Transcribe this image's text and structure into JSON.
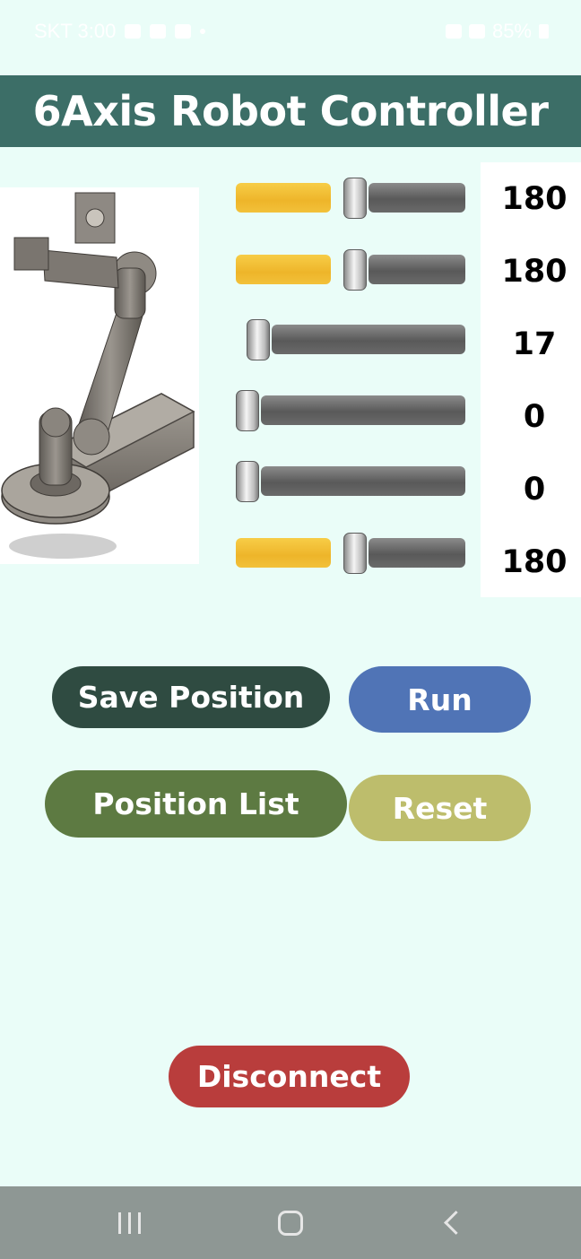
{
  "status_bar": {
    "carrier_time": "SKT 3:00",
    "battery": "85%"
  },
  "title": "6Axis Robot Controller",
  "robot_image": {
    "icon": "robot-arm-image"
  },
  "sliders": [
    {
      "value": "180",
      "level": 0.52,
      "has_fill": true
    },
    {
      "value": "180",
      "level": 0.52,
      "has_fill": true
    },
    {
      "value": "17",
      "level": 0.05,
      "has_fill": false
    },
    {
      "value": "0",
      "level": 0.0,
      "has_fill": false
    },
    {
      "value": "0",
      "level": 0.0,
      "has_fill": false
    },
    {
      "value": "180",
      "level": 0.52,
      "has_fill": true
    }
  ],
  "buttons": {
    "save_position": "Save Position",
    "run": "Run",
    "position_list": "Position List",
    "reset": "Reset",
    "disconnect": "Disconnect"
  },
  "colors": {
    "background": "#eafdf8",
    "title_bar": "#3c6e67",
    "slider_fill": "#eeb52a",
    "save_button": "#2f4b41",
    "run_button": "#5074b6",
    "position_list_button": "#5d7a42",
    "reset_button": "#bdbd6c",
    "disconnect_button": "#b93d3c"
  }
}
